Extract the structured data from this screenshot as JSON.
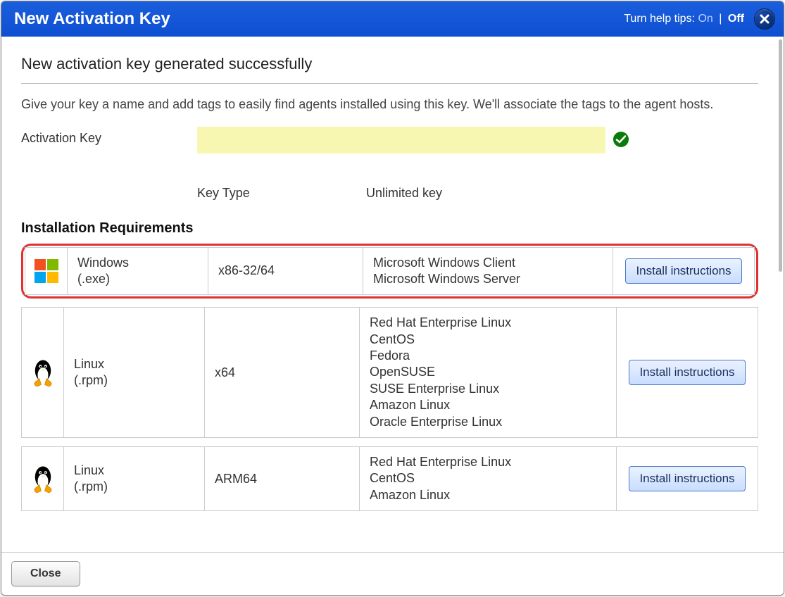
{
  "titlebar": {
    "title": "New Activation Key",
    "help_prefix": "Turn help tips:",
    "help_on": "On",
    "help_off": "Off"
  },
  "page": {
    "heading": "New activation key generated successfully",
    "description": "Give your key a name and add tags to easily find agents installed using this key. We'll associate the tags to the agent hosts.",
    "key_label": "Activation Key",
    "key_value": "",
    "keytype_label": "Key Type",
    "keytype_value": "Unlimited key",
    "section_title": "Installation Requirements"
  },
  "requirements": [
    {
      "os": "Windows",
      "pkg": "(.exe)",
      "arch": "x86-32/64",
      "distros": [
        "Microsoft Windows Client",
        "Microsoft Windows Server"
      ],
      "button": "Install instructions",
      "icon": "windows",
      "highlighted": true
    },
    {
      "os": "Linux",
      "pkg": "(.rpm)",
      "arch": "x64",
      "distros": [
        "Red Hat Enterprise Linux",
        "CentOS",
        "Fedora",
        "OpenSUSE",
        "SUSE Enterprise Linux",
        "Amazon Linux",
        "Oracle Enterprise Linux"
      ],
      "button": "Install instructions",
      "icon": "linux",
      "highlighted": false
    },
    {
      "os": "Linux",
      "pkg": "(.rpm)",
      "arch": "ARM64",
      "distros": [
        "Red Hat Enterprise Linux",
        "CentOS",
        "Amazon Linux"
      ],
      "button": "Install instructions",
      "icon": "linux",
      "highlighted": false
    }
  ],
  "footer": {
    "close": "Close"
  }
}
